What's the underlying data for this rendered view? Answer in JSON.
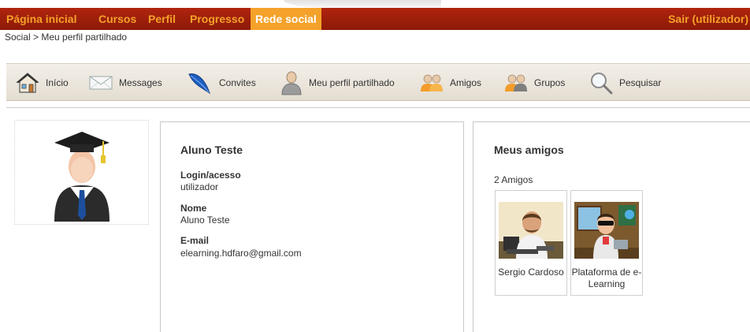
{
  "topnav": {
    "items": [
      {
        "label": "Página inicial",
        "active": false
      },
      {
        "label": "Cursos",
        "active": false
      },
      {
        "label": "Perfil",
        "active": false
      },
      {
        "label": "Progresso",
        "active": false
      },
      {
        "label": "Rede social",
        "active": true
      }
    ],
    "logout": "Sair (utilizador)"
  },
  "breadcrumb": "Social > Meu perfil partilhado",
  "toolbar": {
    "items": [
      {
        "label": "Início",
        "icon": "home-icon"
      },
      {
        "label": "Messages",
        "icon": "envelope-icon"
      },
      {
        "label": "Convites",
        "icon": "feather-icon"
      },
      {
        "label": "Meu perfil partilhado",
        "icon": "user-icon"
      },
      {
        "label": "Amigos",
        "icon": "friends-icon"
      },
      {
        "label": "Grupos",
        "icon": "groups-icon"
      },
      {
        "label": "Pesquisar",
        "icon": "magnifier-icon"
      }
    ]
  },
  "profile": {
    "name": "Aluno Teste",
    "fields": [
      {
        "label": "Login/acesso",
        "value": "utilizador"
      },
      {
        "label": "Nome",
        "value": "Aluno Teste"
      },
      {
        "label": "E-mail",
        "value": "elearning.hdfaro@gmail.com"
      }
    ]
  },
  "friends": {
    "title": "Meus amigos",
    "count": "2 Amigos",
    "list": [
      {
        "name": "Sergio Cardoso"
      },
      {
        "name": "Plataforma de e-Learning"
      }
    ]
  },
  "colors": {
    "nav_bg": "#a31f0b",
    "nav_text": "#f4a22a",
    "nav_active_bg": "#f4a22a",
    "toolbar_bg": "#ece6dc"
  }
}
